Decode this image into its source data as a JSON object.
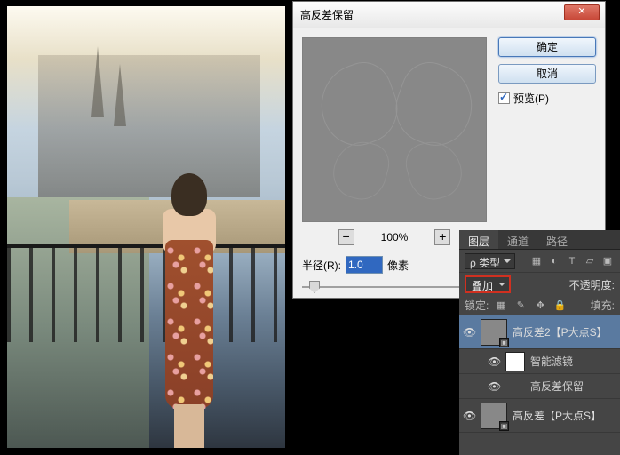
{
  "dialog": {
    "title": "高反差保留",
    "ok": "确定",
    "cancel": "取消",
    "preview_label": "预览(P)",
    "zoom_pct": "100%",
    "radius_label": "半径(R):",
    "radius_value": "1.0",
    "radius_unit": "像素"
  },
  "panel": {
    "tabs": {
      "layers": "图层",
      "channels": "通道",
      "paths": "路径"
    },
    "kind_label": "类型",
    "blend_mode": "叠加",
    "opacity_label": "不透明度:",
    "lock_label": "锁定:",
    "fill_label": "填充:",
    "layers": [
      {
        "name": "高反差2【P大点S】",
        "selected": true,
        "smart": true
      },
      {
        "name": "智能滤镜",
        "sub": true,
        "thumb": "white"
      },
      {
        "name": "高反差保留",
        "sub": true,
        "fx": true
      },
      {
        "name": "高反差【P大点S】",
        "smart": true
      }
    ]
  }
}
